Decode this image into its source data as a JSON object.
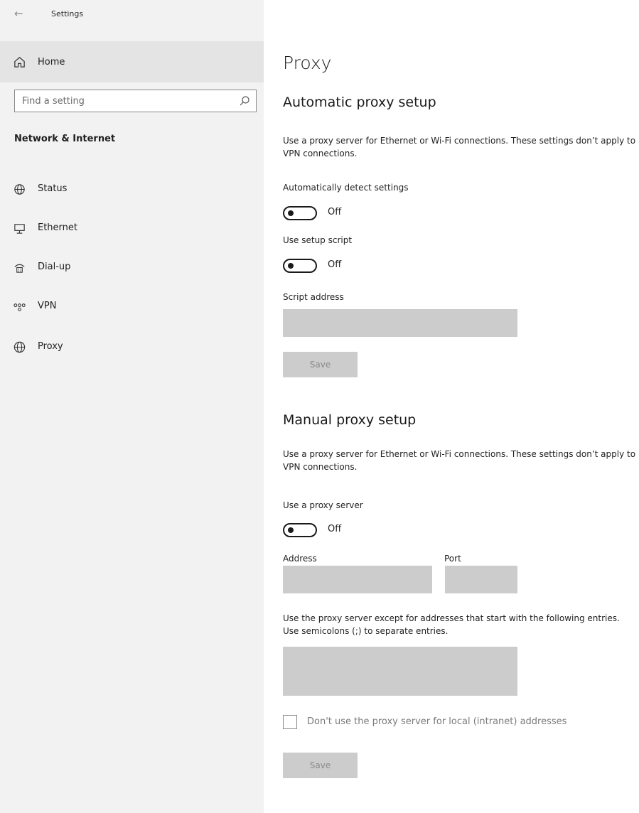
{
  "app": {
    "title": "Settings"
  },
  "sidebar": {
    "home_label": "Home",
    "search_placeholder": "Find a setting",
    "section_title": "Network & Internet",
    "items": [
      {
        "label": "Status",
        "icon": "status-globe-icon"
      },
      {
        "label": "Ethernet",
        "icon": "ethernet-icon"
      },
      {
        "label": "Dial-up",
        "icon": "dial-up-icon"
      },
      {
        "label": "VPN",
        "icon": "vpn-icon"
      },
      {
        "label": "Proxy",
        "icon": "globe-icon"
      }
    ]
  },
  "main": {
    "title": "Proxy",
    "automatic": {
      "heading": "Automatic proxy setup",
      "description": "Use a proxy server for Ethernet or Wi-Fi connections. These settings don’t apply to VPN connections.",
      "detect_label": "Automatically detect settings",
      "detect_state": "Off",
      "script_label": "Use setup script",
      "script_state": "Off",
      "script_address_label": "Script address",
      "script_address_value": "",
      "save_label": "Save"
    },
    "manual": {
      "heading": "Manual proxy setup",
      "description": "Use a proxy server for Ethernet or Wi-Fi connections. These settings don’t apply to VPN connections.",
      "use_proxy_label": "Use a proxy server",
      "use_proxy_state": "Off",
      "address_label": "Address",
      "address_value": "",
      "port_label": "Port",
      "port_value": "",
      "exceptions_description": "Use the proxy server except for addresses that start with the following entries. Use semicolons (;) to separate entries.",
      "exceptions_value": "",
      "local_checkbox_label": "Don't use the proxy server for local (intranet) addresses",
      "local_checkbox_checked": false,
      "save_label": "Save"
    }
  },
  "colors": {
    "sidebar_bg": "#f2f2f2",
    "selected_bg": "#e4e4e4",
    "field_bg": "#cccccc",
    "disabled_text": "#8a8a8a"
  }
}
